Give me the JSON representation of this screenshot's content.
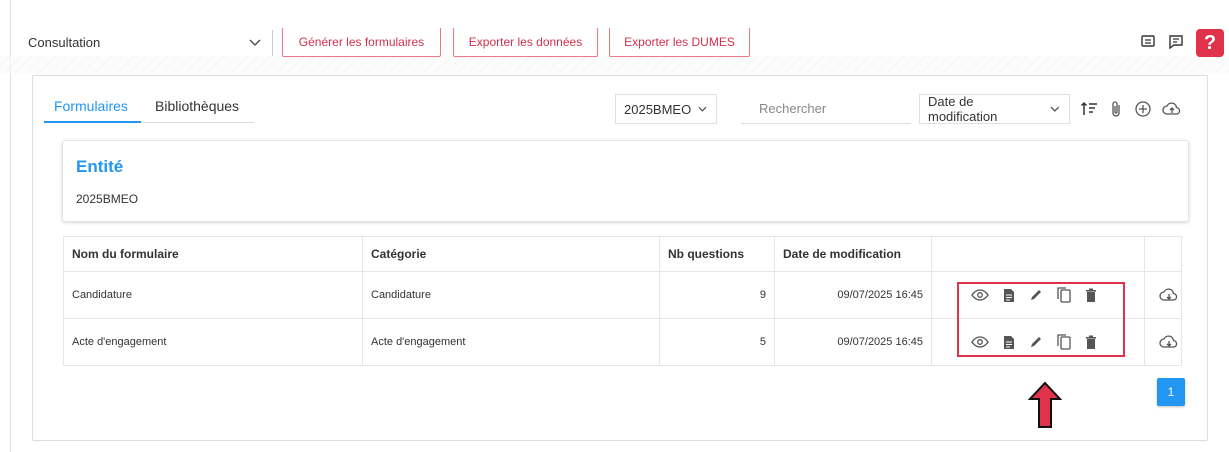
{
  "toolbar": {
    "select_value": "Consultation",
    "buttons": [
      "Générer les formulaires",
      "Exporter les données",
      "Exporter les DUMES"
    ],
    "help_label": "?"
  },
  "tabs": [
    "Formulaires",
    "Bibliothèques"
  ],
  "filters": {
    "entity_select": "2025BMEO",
    "search_placeholder": "Rechercher",
    "sort_select": "Date de modification"
  },
  "entity": {
    "title": "Entité",
    "value": "2025BMEO"
  },
  "table": {
    "headers": [
      "Nom du formulaire",
      "Catégorie",
      "Nb questions",
      "Date de modification"
    ],
    "rows": [
      {
        "name": "Candidature",
        "category": "Candidature",
        "questions": "9",
        "date": "09/07/2025 16:45"
      },
      {
        "name": "Acte d'engagement",
        "category": "Acte d'engagement",
        "questions": "5",
        "date": "09/07/2025 16:45"
      }
    ]
  },
  "pagination": {
    "current": "1"
  },
  "colors": {
    "accent": "#2196f3",
    "brand_red": "#e0324b",
    "highlight": "#e0324b"
  },
  "icons": [
    "view-icon",
    "document-icon",
    "edit-icon",
    "copy-icon",
    "delete-icon",
    "cloud-download-icon"
  ]
}
